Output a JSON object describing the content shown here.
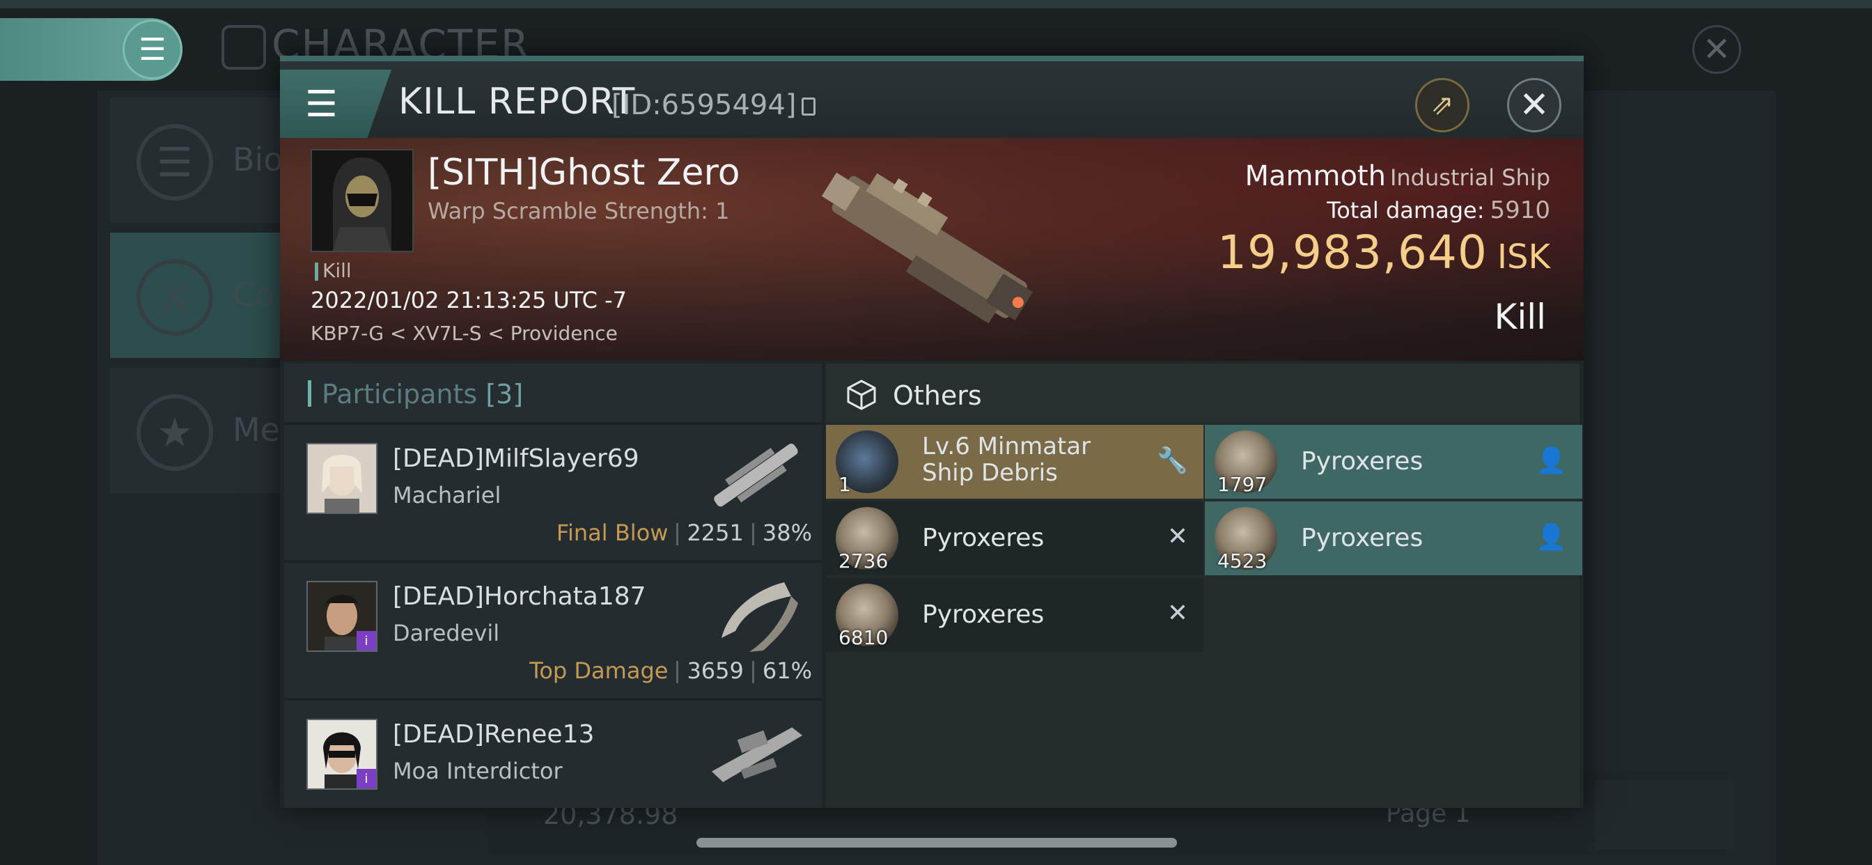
{
  "background": {
    "title": "CHARACTER",
    "cards": [
      {
        "label": "Bio"
      },
      {
        "label": "Co"
      },
      {
        "label": "Me"
      }
    ],
    "footer_value": "20,378.98",
    "page_label": "Page 1"
  },
  "modal": {
    "title": "KILL REPORT",
    "id_text": "[ID:6595494]",
    "victim": {
      "name": "[SITH]Ghost Zero",
      "warp_scramble": "Warp Scramble Strength: 1",
      "kill_tag": "Kill",
      "datetime": "2022/01/02 21:13:25 UTC -7",
      "location": "KBP7-G < XV7L-S < Providence",
      "ship_name": "Mammoth",
      "ship_class": "Industrial Ship",
      "total_damage_label": "Total damage:",
      "total_damage": "5910",
      "isk_value": "19,983,640",
      "isk_unit": "ISK",
      "result": "Kill"
    },
    "participants": {
      "title": "Participants",
      "count": "[3]",
      "rows": [
        {
          "name": "[DEAD]MilfSlayer69",
          "ship": "Machariel",
          "tag": "Final Blow",
          "damage": "2251",
          "percent": "38%"
        },
        {
          "name": "[DEAD]Horchata187",
          "ship": "Daredevil",
          "tag": "Top Damage",
          "damage": "3659",
          "percent": "61%"
        },
        {
          "name": "[DEAD]Renee13",
          "ship": "Moa Interdictor",
          "tag": "",
          "damage": "",
          "percent": ""
        }
      ]
    },
    "others": {
      "title": "Others",
      "items": [
        {
          "name": "Lv.6 Minmatar Ship Debris",
          "qty": "1",
          "status": "wrench-icon"
        },
        {
          "name": "Pyroxeres",
          "qty": "1797",
          "status": "person-icon"
        },
        {
          "name": "Pyroxeres",
          "qty": "2736",
          "status": "destroyed-icon"
        },
        {
          "name": "Pyroxeres",
          "qty": "4523",
          "status": "person-icon"
        },
        {
          "name": "Pyroxeres",
          "qty": "6810",
          "status": "destroyed-icon"
        }
      ]
    }
  },
  "colors": {
    "accent_teal": "#3f6865",
    "isk_gold": "#f5cf8a",
    "tag_gold": "#c49a54",
    "debris_gold": "#7a6a48"
  }
}
